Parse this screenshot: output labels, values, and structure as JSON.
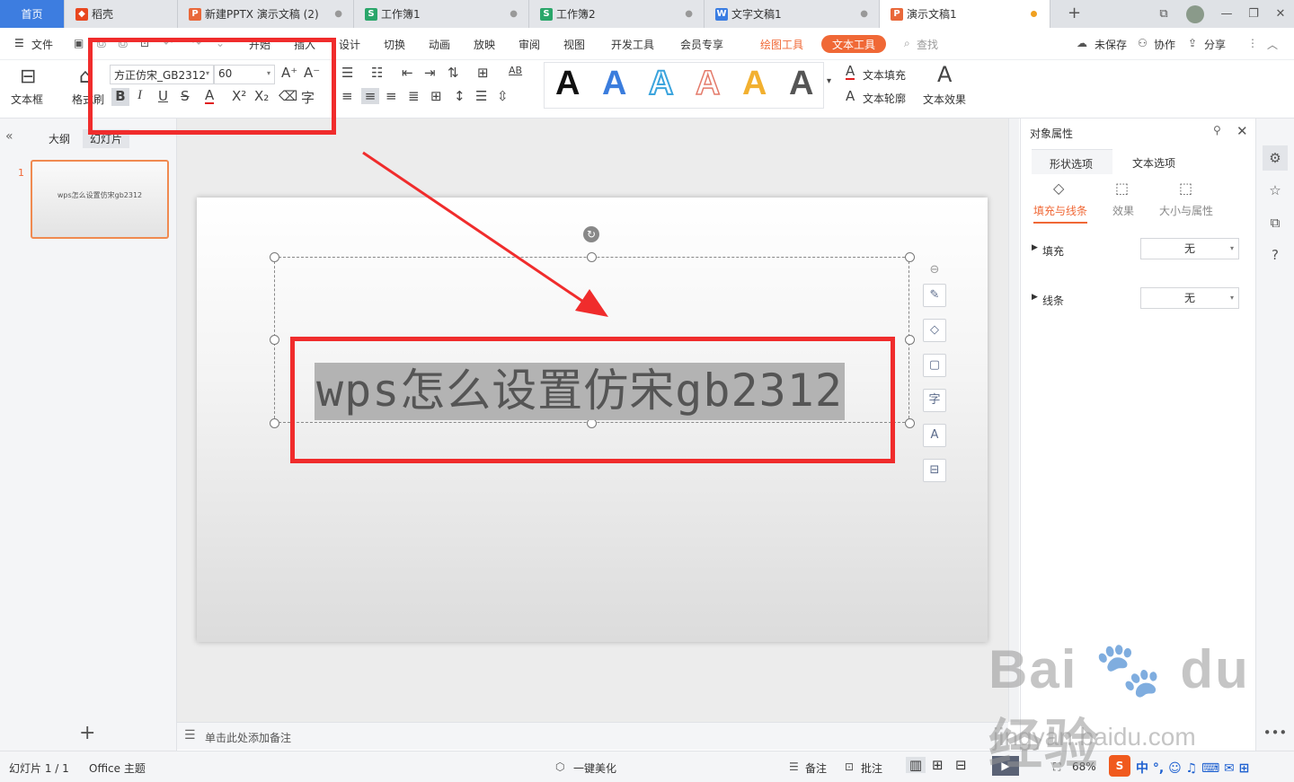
{
  "tabs": [
    {
      "label": "首页"
    },
    {
      "label": "稻壳",
      "icon": "docer-icon"
    },
    {
      "label": "新建PPTX 演示文稿 (2)",
      "icon": "ppt-icon"
    },
    {
      "label": "工作簿1",
      "icon": "sheet-icon"
    },
    {
      "label": "工作簿2",
      "icon": "sheet-icon"
    },
    {
      "label": "文字文稿1",
      "icon": "word-icon"
    },
    {
      "label": "演示文稿1",
      "icon": "ppt-icon"
    }
  ],
  "menu": {
    "file": "文件",
    "items": [
      "开始",
      "插入",
      "设计",
      "切换",
      "动画",
      "放映",
      "审阅",
      "视图",
      "开发工具",
      "会员专享"
    ],
    "drawing_tools": "绘图工具",
    "text_tools": "文本工具",
    "search": "查找",
    "unsaved": "未保存",
    "collab": "协作",
    "share": "分享"
  },
  "ribbon": {
    "textbox": "文本框",
    "format_painter": "格式刷",
    "font_name": "方正仿宋_GB2312",
    "font_size": "60",
    "text_fill": "文本填充",
    "text_outline": "文本轮廓",
    "text_effect": "文本效果"
  },
  "colors": {
    "accent": "#f06836",
    "home_tab": "#3d7de0",
    "highlight_box": "#f02c2c"
  },
  "left_panel": {
    "outline_tab": "大纲",
    "slides_tab": "幻灯片",
    "slide_number": "1",
    "thumb_text": "wps怎么设置仿宋gb2312"
  },
  "slide": {
    "text": "wps怎么设置仿宋gb2312"
  },
  "notes": {
    "placeholder": "单击此处添加备注"
  },
  "right_panel": {
    "title": "对象属性",
    "tab_shape": "形状选项",
    "tab_text": "文本选项",
    "sub_fill_line": "填充与线条",
    "sub_effect": "效果",
    "sub_size": "大小与属性",
    "fill_label": "填充",
    "fill_value": "无",
    "line_label": "线条",
    "line_value": "无"
  },
  "status": {
    "slide_counter": "幻灯片 1 / 1",
    "theme": "Office 主题",
    "beautify": "一键美化",
    "notes": "备注",
    "comments": "批注",
    "zoom": "68%"
  },
  "watermark": {
    "logo": "Bai du 经验",
    "url": "jingyan.baidu.com"
  }
}
